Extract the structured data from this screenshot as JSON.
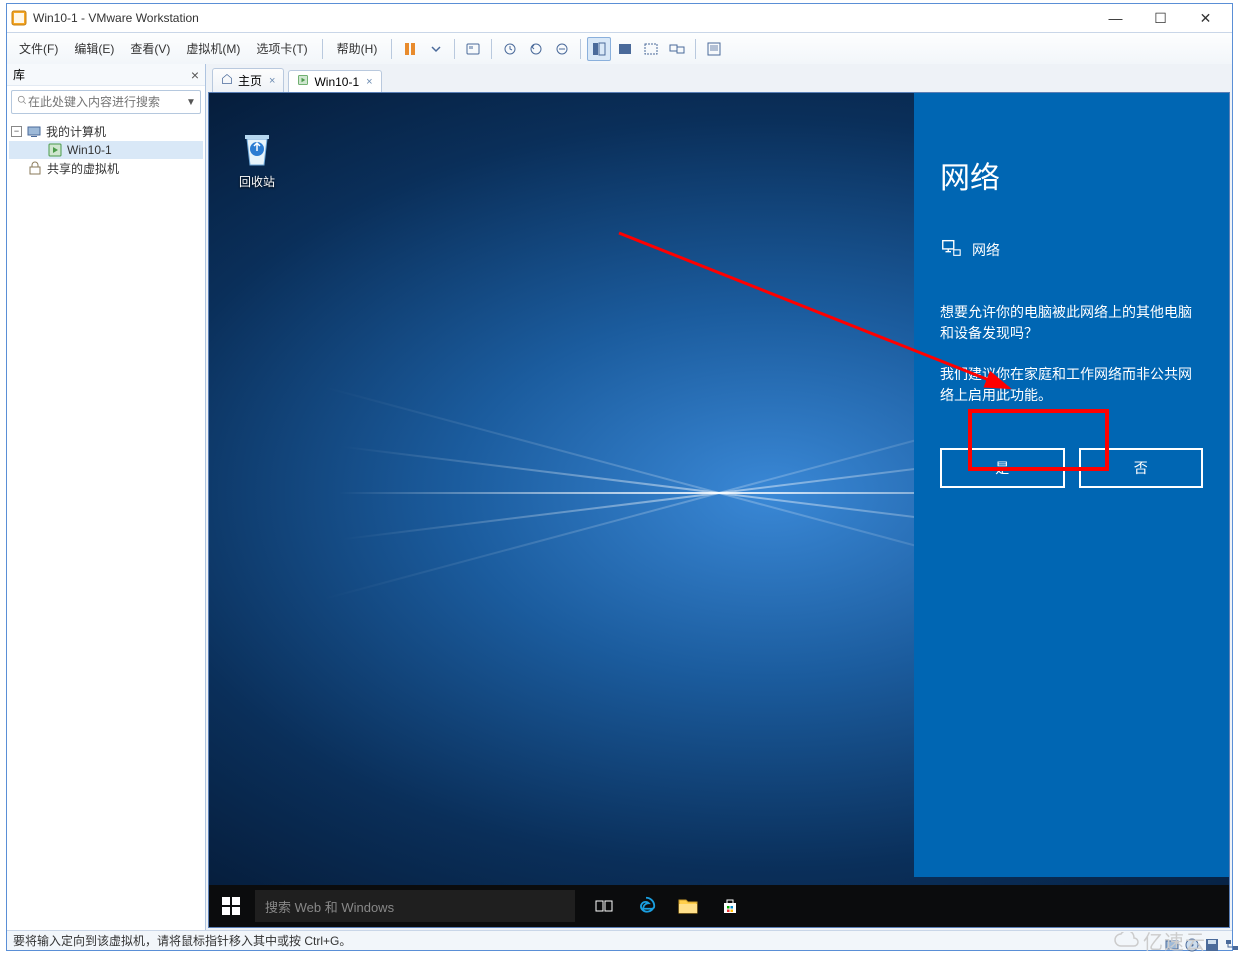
{
  "window": {
    "title": "Win10-1 - VMware Workstation"
  },
  "menu": {
    "file": "文件(F)",
    "edit": "编辑(E)",
    "view": "查看(V)",
    "vm": "虚拟机(M)",
    "tabs": "选项卡(T)",
    "help": "帮助(H)"
  },
  "sidebar": {
    "title": "库",
    "search_placeholder": "在此处键入内容进行搜索",
    "tree": {
      "root": "我的计算机",
      "vm": "Win10-1",
      "shared": "共享的虚拟机"
    }
  },
  "tabs": {
    "home": "主页",
    "vm": "Win10-1"
  },
  "guest": {
    "recycle_bin": "回收站",
    "search_placeholder": "搜索 Web 和 Windows",
    "network": {
      "title": "网络",
      "label": "网络",
      "q1": "想要允许你的电脑被此网络上的其他电脑和设备发现吗？",
      "q2": "我们建议你在家庭和工作网络而非公共网络上启用此功能。",
      "yes": "是",
      "no": "否"
    }
  },
  "statusbar": {
    "hint": "要将输入定向到该虚拟机，请将鼠标指针移入其中或按 Ctrl+G。"
  },
  "watermark": "亿速云"
}
